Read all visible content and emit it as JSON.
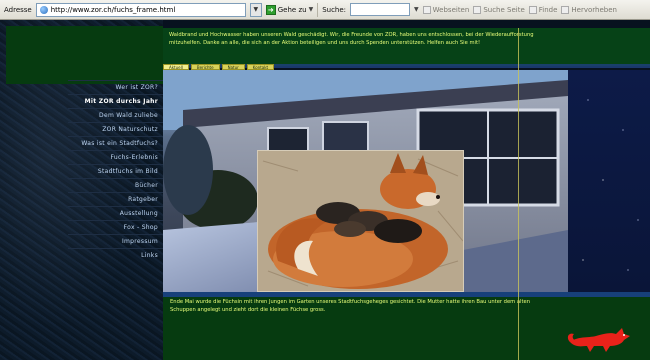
{
  "browser": {
    "address_label": "Adresse",
    "url": "http://www.zor.ch/fuchs_frame.html",
    "go_label": "Gehe zu",
    "search_label": "Suche:",
    "toolbar_items": [
      "Webseiten",
      "Suche Seite",
      "Finde",
      "Hervorheben"
    ]
  },
  "nav": {
    "items": [
      "Wer ist ZOR?",
      "Mit ZOR durchs Jahr",
      "Dem Wald zuliebe",
      "ZOR Naturschutz",
      "Was ist ein Stadtfuchs?",
      "Fuchs-Erlebnis",
      "Stadtfuchs im Bild",
      "Bücher",
      "Ratgeber",
      "Ausstellung",
      "Fox - Shop",
      "Impressum",
      "Links"
    ],
    "highlighted_index": 1
  },
  "top_text": "Waldbrand und Hochwasser haben unseren Wald geschädigt. Wir, die Freunde von ZOR, haben uns entschlossen, bei der Wiederaufforstung mitzuhelfen. Danke an alle, die sich an der Aktion beteiligen und uns durch Spenden unterstützen. Helfen auch Sie mit!",
  "tabs": [
    "Aktuell",
    "Berichte",
    "Natur",
    "Kontakt"
  ],
  "bottom_text": "Ende Mai wurde die Füchsin mit ihren Jungen im Garten unseres Stadtfuchsgeheges gesichtet. Die Mutter hatte ihren Bau unter dem alten Schuppen angelegt und zieht dort die kleinen Füchse gross.",
  "colors": {
    "green_panel": "#064217",
    "yellow_text": "#e9ff7a",
    "nav_text": "#bfd6f2",
    "fox_red": "#e8221a"
  },
  "icons": {
    "globe": "globe-icon",
    "go": "go-arrow-icon",
    "logo": "fox-logo-icon"
  }
}
